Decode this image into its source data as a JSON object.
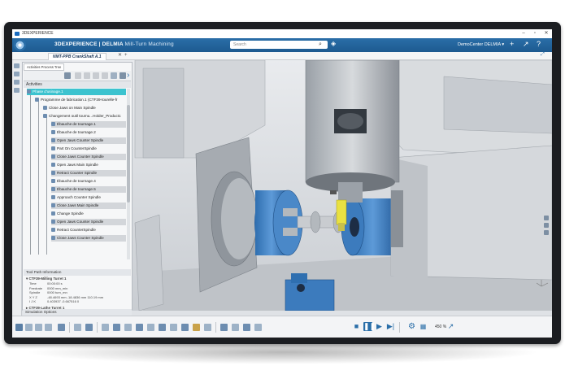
{
  "window": {
    "title": "3DEXPERIENCE",
    "minimize_icon": "–",
    "restore_icon": "▫",
    "close_icon": "✕"
  },
  "topbar": {
    "brand_prefix": "3DEXPERIENCE | DELMIA",
    "app_name": "Mill-Turn Machining",
    "search_placeholder": "Search",
    "user": "DemoCenter DELMIA ▾",
    "accent": "#1d5a90"
  },
  "tabs": [
    {
      "label": "NMT-PPB CrankShaft A.1"
    }
  ],
  "panel": {
    "tab_label": "Activities Process Tree",
    "tree_header": "Activities",
    "tree_items": [
      {
        "label": "Phase d'usinage.1",
        "state": "selected"
      },
      {
        "label": "Programme de fabrication.1 (CTF39-tourelle-fr",
        "state": "normal"
      },
      {
        "label": "Close Jaws on Main Spindle",
        "state": "normal"
      },
      {
        "label": "Changement outil tournu...Holder_Product1",
        "state": "normal"
      },
      {
        "label": "Ébauche de tournage.1",
        "state": "grey"
      },
      {
        "label": "Ébauche de tournage.2",
        "state": "normal"
      },
      {
        "label": "Open Jaws Counter Spindle",
        "state": "grey"
      },
      {
        "label": "Part On CounterSpindle",
        "state": "normal"
      },
      {
        "label": "Close Jaws Counter Spindle",
        "state": "grey"
      },
      {
        "label": "Open Jaws Main Spindle",
        "state": "normal"
      },
      {
        "label": "Retract Counter Spindle",
        "state": "grey"
      },
      {
        "label": "Ébauche de tournage.4",
        "state": "normal"
      },
      {
        "label": "Ébauche de tournage.5",
        "state": "grey"
      },
      {
        "label": "Approach Counter Spindle",
        "state": "normal"
      },
      {
        "label": "Close Jaws Main Spindle",
        "state": "grey"
      },
      {
        "label": "Change Spindle",
        "state": "normal"
      },
      {
        "label": "Open Jaws Counter Spindle",
        "state": "grey"
      },
      {
        "label": "Retract CounterSpindle",
        "state": "normal"
      },
      {
        "label": "Close Jaws Counter Spindle",
        "state": "grey"
      }
    ],
    "tool_path_header": "Tool Path Information",
    "turret1": {
      "label": "CTF39-Milling Turret 1",
      "rows": [
        {
          "k": "Time",
          "v": "00:00:00 s"
        },
        {
          "k": "Feedrate",
          "v": "0000 mm_min"
        },
        {
          "k": "Spindle",
          "v": "0000 turn_mn"
        },
        {
          "k": "X  Y  Z",
          "v": "-48.4693 mm   -18.4836 mm   110.19 mm"
        },
        {
          "k": "I  J  K",
          "v": "0.403937   -0.667516   0"
        }
      ]
    },
    "turret2": {
      "label": "CTF39-Lathe Turret 1"
    },
    "sim_options_header": "Simulation Options"
  },
  "bottom_tabs": [
    {
      "label": "Standard",
      "active": false
    },
    {
      "label": "Setup",
      "active": false
    },
    {
      "label": "Programming",
      "active": false
    },
    {
      "label": "Prismatic Machining",
      "active": false
    },
    {
      "label": "Surface Machining",
      "active": false
    },
    {
      "label": "Lathe Machining",
      "active": false
    },
    {
      "label": "Axial Machining",
      "active": false
    },
    {
      "label": "Analysis & Output",
      "active": false
    },
    {
      "label": "View",
      "active": false
    },
    {
      "label": "AR-VR",
      "active": false
    },
    {
      "label": "Tools",
      "active": false
    },
    {
      "label": "Touch",
      "active": false
    },
    {
      "label": "Player",
      "active": true
    }
  ],
  "player": {
    "speed_label": "450 %"
  }
}
